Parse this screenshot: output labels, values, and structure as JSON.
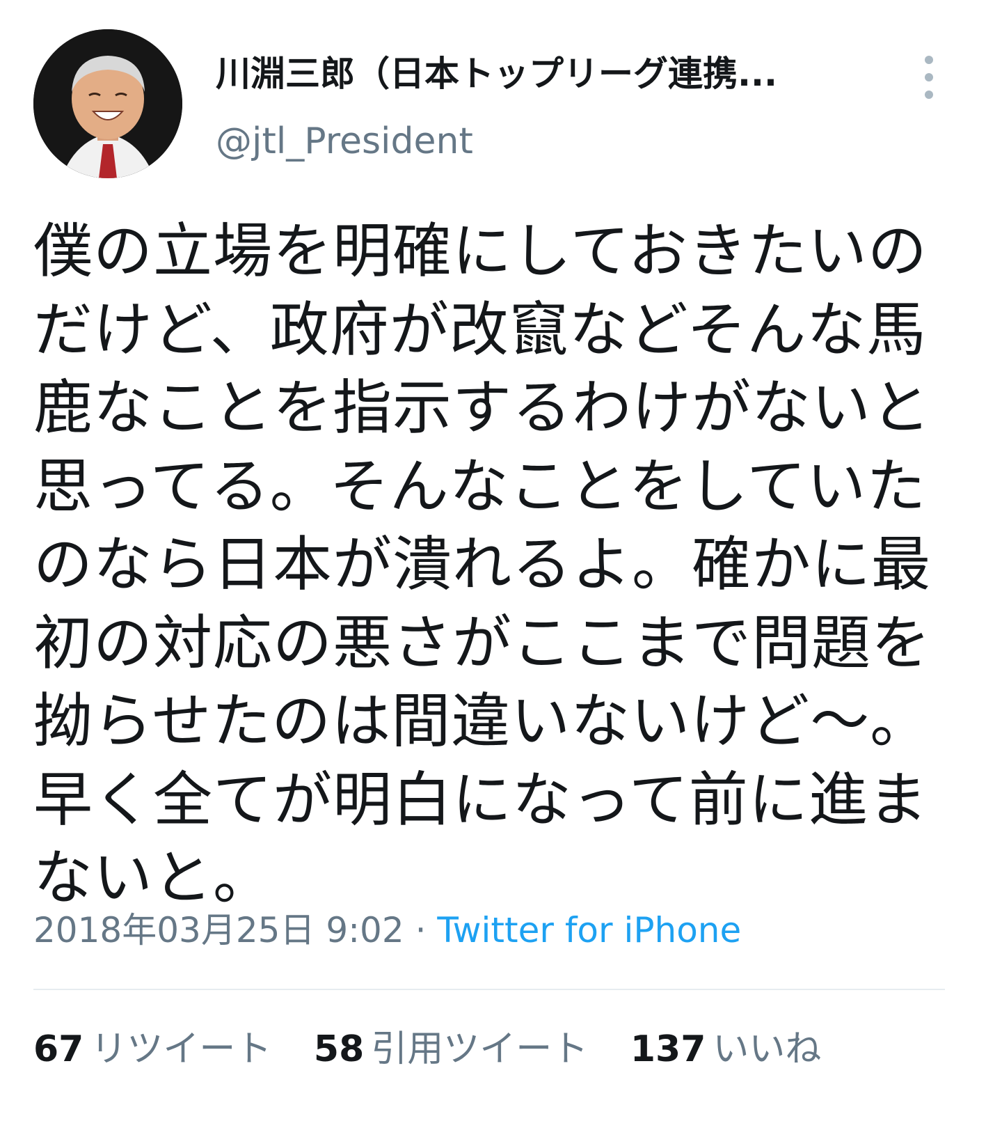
{
  "user": {
    "display_name": "川淵三郎（日本トップリーグ連携...",
    "handle": "@jtl_President"
  },
  "tweet": {
    "text": "僕の立場を明確にしておきたいのだけど、政府が改竄などそんな馬鹿なことを指示するわけがないと思ってる。そんなことをしていたのなら日本が潰れるよ。確かに最初の対応の悪さがここまで問題を拗らせたのは間違いないけど〜。早く全てが明白になって前に進まないと。",
    "timestamp": "2018年03月25日 9:02",
    "separator": " · ",
    "source": "Twitter for iPhone"
  },
  "stats": {
    "retweets": {
      "count": "67",
      "label": "リツイート"
    },
    "quotes": {
      "count": "58",
      "label": "引用ツイート"
    },
    "likes": {
      "count": "137",
      "label": "いいね"
    }
  },
  "icons": {
    "more": "vertical-dots-icon"
  },
  "colors": {
    "text": "#14171a",
    "secondary": "#657786",
    "link": "#1da1f2",
    "divider": "#e6ecf0"
  }
}
